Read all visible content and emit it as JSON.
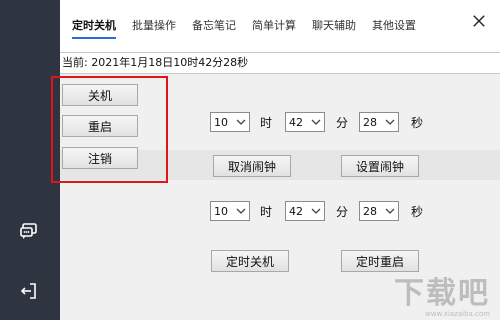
{
  "tabs": [
    "定时关机",
    "批量操作",
    "备忘笔记",
    "简单计算",
    "聊天辅助",
    "其他设置"
  ],
  "current_time": "当前: 2021年1月18日10时42分28秒",
  "power_buttons": {
    "shutdown": "关机",
    "restart": "重启",
    "logoff": "注销"
  },
  "row1": {
    "hour": "10",
    "minute": "42",
    "second": "28"
  },
  "row2": {
    "hour": "10",
    "minute": "42",
    "second": "28"
  },
  "units": {
    "hour": "时",
    "minute": "分",
    "second": "秒"
  },
  "alarm_buttons": {
    "cancel": "取消闹钟",
    "set": "设置闹钟"
  },
  "timer_buttons": {
    "shutdown": "定时关机",
    "restart": "定时重启"
  },
  "watermark": {
    "text": "下载吧",
    "sub": "www.xiazaiba.com"
  },
  "colors": {
    "sidebar": "#2e3440",
    "highlight": "#e0141b",
    "accent": "#2a6dd8"
  },
  "icons": {
    "chat": "chat-icon",
    "logout": "logout-icon",
    "close": "close-icon"
  }
}
